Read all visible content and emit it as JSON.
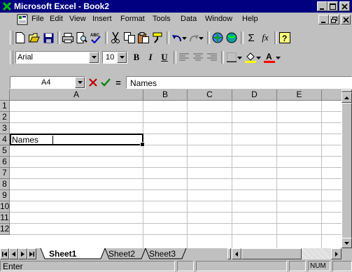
{
  "window": {
    "title": "Microsoft Excel - Book2",
    "app_icon": "excel-x-icon",
    "accent": "#000080"
  },
  "menu": {
    "items": [
      {
        "label": "File",
        "key": "F"
      },
      {
        "label": "Edit",
        "key": "E"
      },
      {
        "label": "View",
        "key": "V"
      },
      {
        "label": "Insert",
        "key": "I"
      },
      {
        "label": "Format",
        "key": "o"
      },
      {
        "label": "Tools",
        "key": "T"
      },
      {
        "label": "Data",
        "key": "D"
      },
      {
        "label": "Window",
        "key": "W"
      },
      {
        "label": "Help",
        "key": "H"
      }
    ]
  },
  "formatting": {
    "font": "Arial",
    "size": "10"
  },
  "formula_bar": {
    "name_box": "A4",
    "content": "Names"
  },
  "grid": {
    "columns": [
      "A",
      "B",
      "C",
      "D",
      "E"
    ],
    "rows": [
      "1",
      "2",
      "3",
      "4",
      "5",
      "6",
      "7",
      "8",
      "9",
      "10",
      "11",
      "12"
    ],
    "cell_a4": "Names"
  },
  "sheets": {
    "tabs": [
      "Sheet1",
      "Sheet2",
      "Sheet3"
    ],
    "active": "Sheet1"
  },
  "status": {
    "mode": "Enter",
    "num": "NUM"
  }
}
